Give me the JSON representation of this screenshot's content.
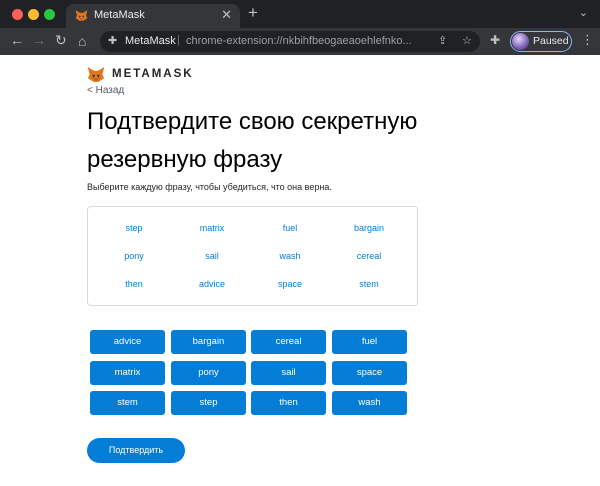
{
  "browser": {
    "tab_title": "MetaMask",
    "tab_close": "✕",
    "new_tab": "+",
    "tab_menu": "⌄",
    "nav": {
      "back": "←",
      "forward": "→",
      "reload": "↻",
      "home": "⌂"
    },
    "omnibox": {
      "site_name": "MetaMask",
      "separator": "|",
      "url": "chrome-extension://nkbihfbeogaeaoehlefnko..."
    },
    "profile_label": "Paused",
    "icons": {
      "share": "⇪",
      "key": "⚿",
      "star": "☆",
      "puzzle": "✚",
      "kebab": "⋮",
      "extension": "✚"
    }
  },
  "header": {
    "brand": "METAMASK",
    "back_link": "< Назад"
  },
  "main": {
    "title": "Подтвердите свою секретную резервную фразу",
    "instruction": "Выберите каждую фразу, чтобы убедиться, что она верна.",
    "word_pool": [
      "step",
      "matrix",
      "fuel",
      "bargain",
      "pony",
      "sail",
      "wash",
      "cereal",
      "then",
      "advice",
      "space",
      "stem"
    ],
    "selected_words": [
      "advice",
      "bargain",
      "cereal",
      "fuel",
      "matrix",
      "pony",
      "sail",
      "space",
      "stem",
      "step",
      "then",
      "wash"
    ],
    "confirm_label": "Подтвердить"
  },
  "colors": {
    "accent": "#037dd6",
    "title": "#000000",
    "chrome_dark": "#202124",
    "chrome_toolbar": "#35363a"
  }
}
